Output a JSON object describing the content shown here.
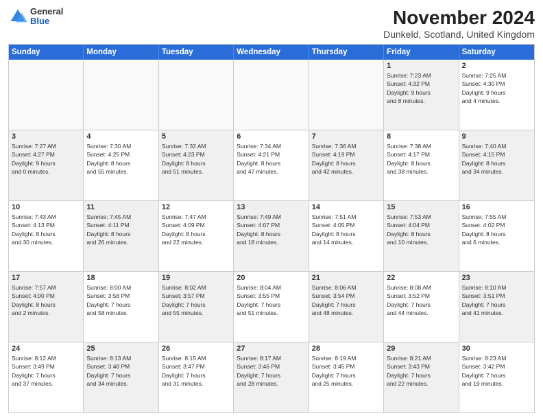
{
  "logo": {
    "general": "General",
    "blue": "Blue"
  },
  "title": "November 2024",
  "subtitle": "Dunkeld, Scotland, United Kingdom",
  "headers": [
    "Sunday",
    "Monday",
    "Tuesday",
    "Wednesday",
    "Thursday",
    "Friday",
    "Saturday"
  ],
  "rows": [
    [
      {
        "day": "",
        "text": "",
        "empty": true
      },
      {
        "day": "",
        "text": "",
        "empty": true
      },
      {
        "day": "",
        "text": "",
        "empty": true
      },
      {
        "day": "",
        "text": "",
        "empty": true
      },
      {
        "day": "",
        "text": "",
        "empty": true
      },
      {
        "day": "1",
        "text": "Sunrise: 7:23 AM\nSunset: 4:32 PM\nDaylight: 9 hours\nand 8 minutes.",
        "shaded": true
      },
      {
        "day": "2",
        "text": "Sunrise: 7:25 AM\nSunset: 4:30 PM\nDaylight: 9 hours\nand 4 minutes.",
        "shaded": false
      }
    ],
    [
      {
        "day": "3",
        "text": "Sunrise: 7:27 AM\nSunset: 4:27 PM\nDaylight: 9 hours\nand 0 minutes.",
        "shaded": true
      },
      {
        "day": "4",
        "text": "Sunrise: 7:30 AM\nSunset: 4:25 PM\nDaylight: 8 hours\nand 55 minutes.",
        "shaded": false
      },
      {
        "day": "5",
        "text": "Sunrise: 7:32 AM\nSunset: 4:23 PM\nDaylight: 8 hours\nand 51 minutes.",
        "shaded": true
      },
      {
        "day": "6",
        "text": "Sunrise: 7:34 AM\nSunset: 4:21 PM\nDaylight: 8 hours\nand 47 minutes.",
        "shaded": false
      },
      {
        "day": "7",
        "text": "Sunrise: 7:36 AM\nSunset: 4:19 PM\nDaylight: 8 hours\nand 42 minutes.",
        "shaded": true
      },
      {
        "day": "8",
        "text": "Sunrise: 7:38 AM\nSunset: 4:17 PM\nDaylight: 8 hours\nand 38 minutes.",
        "shaded": false
      },
      {
        "day": "9",
        "text": "Sunrise: 7:40 AM\nSunset: 4:15 PM\nDaylight: 8 hours\nand 34 minutes.",
        "shaded": true
      }
    ],
    [
      {
        "day": "10",
        "text": "Sunrise: 7:43 AM\nSunset: 4:13 PM\nDaylight: 8 hours\nand 30 minutes.",
        "shaded": false
      },
      {
        "day": "11",
        "text": "Sunrise: 7:45 AM\nSunset: 4:11 PM\nDaylight: 8 hours\nand 26 minutes.",
        "shaded": true
      },
      {
        "day": "12",
        "text": "Sunrise: 7:47 AM\nSunset: 4:09 PM\nDaylight: 8 hours\nand 22 minutes.",
        "shaded": false
      },
      {
        "day": "13",
        "text": "Sunrise: 7:49 AM\nSunset: 4:07 PM\nDaylight: 8 hours\nand 18 minutes.",
        "shaded": true
      },
      {
        "day": "14",
        "text": "Sunrise: 7:51 AM\nSunset: 4:05 PM\nDaylight: 8 hours\nand 14 minutes.",
        "shaded": false
      },
      {
        "day": "15",
        "text": "Sunrise: 7:53 AM\nSunset: 4:04 PM\nDaylight: 8 hours\nand 10 minutes.",
        "shaded": true
      },
      {
        "day": "16",
        "text": "Sunrise: 7:55 AM\nSunset: 4:02 PM\nDaylight: 8 hours\nand 6 minutes.",
        "shaded": false
      }
    ],
    [
      {
        "day": "17",
        "text": "Sunrise: 7:57 AM\nSunset: 4:00 PM\nDaylight: 8 hours\nand 2 minutes.",
        "shaded": true
      },
      {
        "day": "18",
        "text": "Sunrise: 8:00 AM\nSunset: 3:58 PM\nDaylight: 7 hours\nand 58 minutes.",
        "shaded": false
      },
      {
        "day": "19",
        "text": "Sunrise: 8:02 AM\nSunset: 3:57 PM\nDaylight: 7 hours\nand 55 minutes.",
        "shaded": true
      },
      {
        "day": "20",
        "text": "Sunrise: 8:04 AM\nSunset: 3:55 PM\nDaylight: 7 hours\nand 51 minutes.",
        "shaded": false
      },
      {
        "day": "21",
        "text": "Sunrise: 8:06 AM\nSunset: 3:54 PM\nDaylight: 7 hours\nand 48 minutes.",
        "shaded": true
      },
      {
        "day": "22",
        "text": "Sunrise: 8:08 AM\nSunset: 3:52 PM\nDaylight: 7 hours\nand 44 minutes.",
        "shaded": false
      },
      {
        "day": "23",
        "text": "Sunrise: 8:10 AM\nSunset: 3:51 PM\nDaylight: 7 hours\nand 41 minutes.",
        "shaded": true
      }
    ],
    [
      {
        "day": "24",
        "text": "Sunrise: 8:12 AM\nSunset: 3:49 PM\nDaylight: 7 hours\nand 37 minutes.",
        "shaded": false
      },
      {
        "day": "25",
        "text": "Sunrise: 8:13 AM\nSunset: 3:48 PM\nDaylight: 7 hours\nand 34 minutes.",
        "shaded": true
      },
      {
        "day": "26",
        "text": "Sunrise: 8:15 AM\nSunset: 3:47 PM\nDaylight: 7 hours\nand 31 minutes.",
        "shaded": false
      },
      {
        "day": "27",
        "text": "Sunrise: 8:17 AM\nSunset: 3:46 PM\nDaylight: 7 hours\nand 28 minutes.",
        "shaded": true
      },
      {
        "day": "28",
        "text": "Sunrise: 8:19 AM\nSunset: 3:45 PM\nDaylight: 7 hours\nand 25 minutes.",
        "shaded": false
      },
      {
        "day": "29",
        "text": "Sunrise: 8:21 AM\nSunset: 3:43 PM\nDaylight: 7 hours\nand 22 minutes.",
        "shaded": true
      },
      {
        "day": "30",
        "text": "Sunrise: 8:23 AM\nSunset: 3:42 PM\nDaylight: 7 hours\nand 19 minutes.",
        "shaded": false
      }
    ]
  ]
}
